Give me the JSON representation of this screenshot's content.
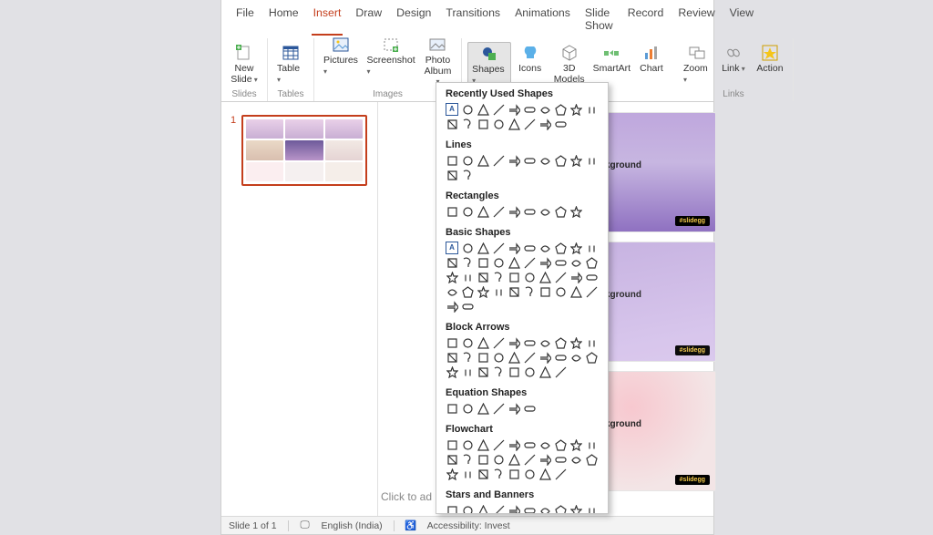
{
  "menu": {
    "items": [
      "File",
      "Home",
      "Insert",
      "Draw",
      "Design",
      "Transitions",
      "Animations",
      "Slide Show",
      "Record",
      "Review",
      "View"
    ],
    "active_index": 2
  },
  "ribbon": {
    "groups": [
      {
        "label": "Slides",
        "buttons": [
          {
            "label": "New\nSlide",
            "has_drop": true
          }
        ]
      },
      {
        "label": "Tables",
        "buttons": [
          {
            "label": "Table",
            "has_drop": true
          }
        ]
      },
      {
        "label": "Images",
        "buttons": [
          {
            "label": "Pictures",
            "has_drop": true
          },
          {
            "label": "Screenshot",
            "has_drop": true
          },
          {
            "label": "Photo\nAlbum",
            "has_drop": true
          }
        ]
      },
      {
        "label": "",
        "buttons": [
          {
            "label": "Shapes",
            "has_drop": true,
            "open": true
          },
          {
            "label": "Icons",
            "has_drop": false
          },
          {
            "label": "3D\nModels",
            "has_drop": true
          },
          {
            "label": "SmartArt",
            "has_drop": false
          },
          {
            "label": "Chart",
            "has_drop": false
          }
        ]
      },
      {
        "label": "Links",
        "buttons": [
          {
            "label": "Zoom",
            "has_drop": true
          },
          {
            "label": "Link",
            "has_drop": true
          },
          {
            "label": "Action",
            "has_drop": false
          }
        ]
      }
    ]
  },
  "dropdown": {
    "categories": [
      {
        "title": "Recently Used Shapes",
        "count": 18
      },
      {
        "title": "Lines",
        "count": 12
      },
      {
        "title": "Rectangles",
        "count": 9
      },
      {
        "title": "Basic Shapes",
        "count": 42
      },
      {
        "title": "Block Arrows",
        "count": 28
      },
      {
        "title": "Equation Shapes",
        "count": 6
      },
      {
        "title": "Flowchart",
        "count": 28
      },
      {
        "title": "Stars and Banners",
        "count": 14
      }
    ]
  },
  "thumbs": {
    "slide_num": "1"
  },
  "canvas": {
    "notes_placeholder": "Click to ad"
  },
  "status": {
    "slide": "Slide 1 of 1",
    "lang": "English (India)",
    "access": "Accessibility: Invest"
  },
  "gallery": {
    "tag1": "#slidegg",
    "tag2": "#slidegg",
    "tag3": "#slidegg",
    "title": "kground"
  }
}
